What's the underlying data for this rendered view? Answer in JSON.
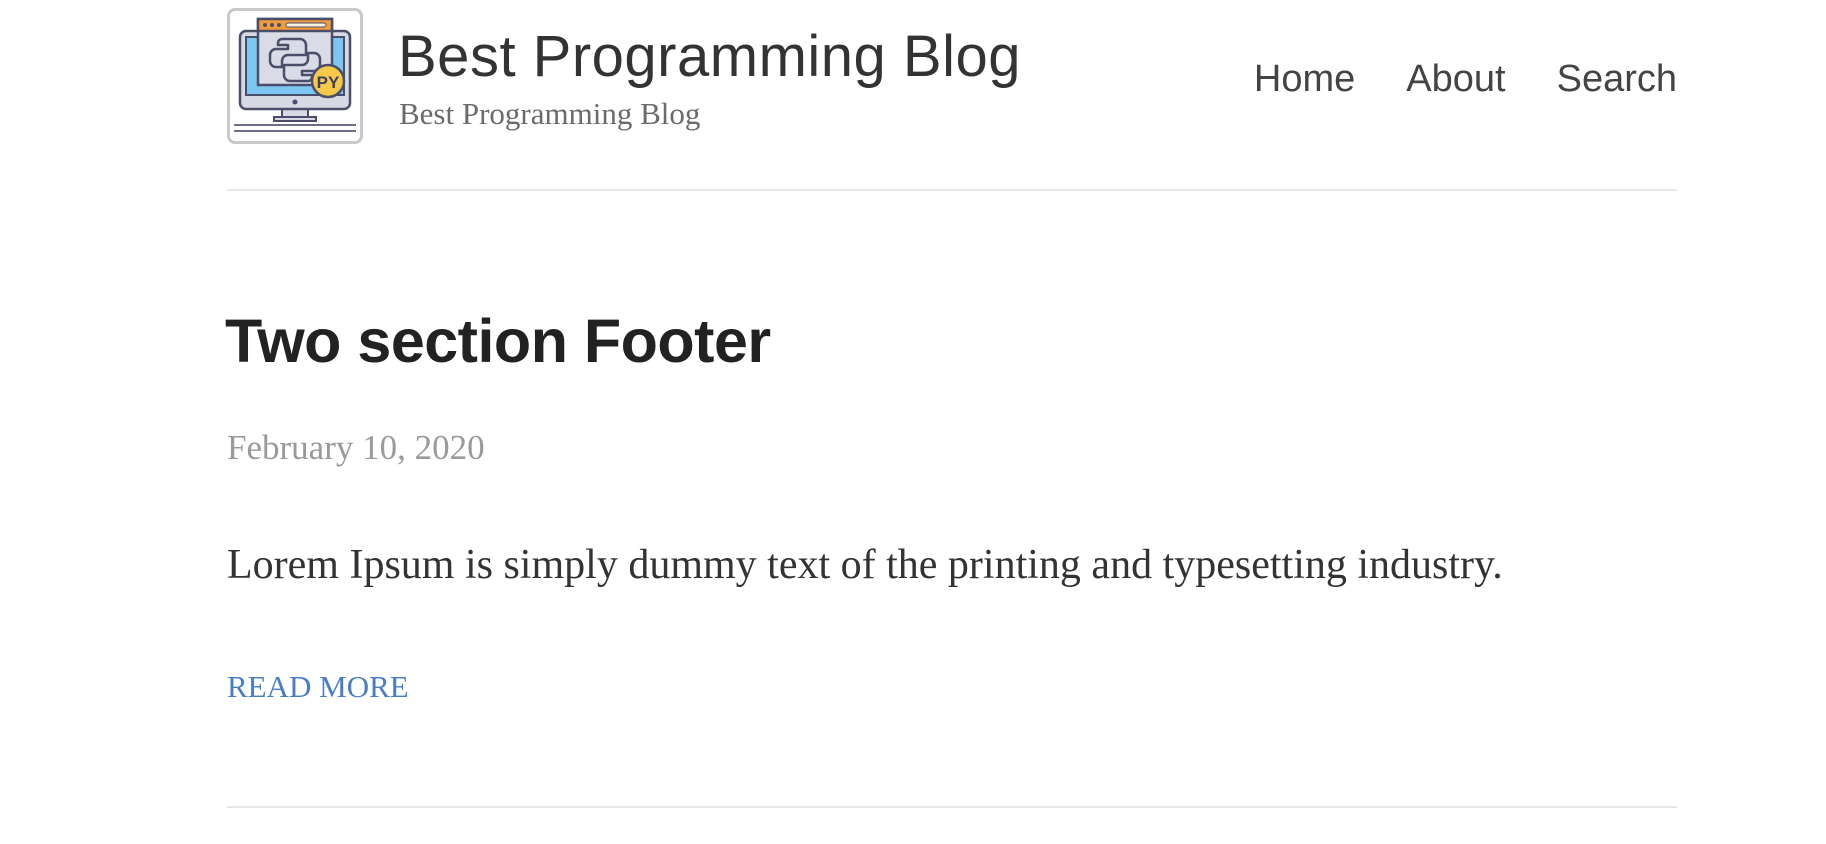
{
  "site": {
    "title": "Best Programming Blog",
    "tagline": "Best Programming Blog",
    "logo_icon": "python-monitor-icon",
    "logo_badge": "PY"
  },
  "nav": {
    "items": [
      {
        "label": "Home"
      },
      {
        "label": "About"
      },
      {
        "label": "Search"
      }
    ]
  },
  "post": {
    "title": "Two section Footer",
    "date": "February 10, 2020",
    "excerpt": "Lorem Ipsum is simply dummy text of the printing and typesetting industry.",
    "read_more": "READ MORE"
  },
  "colors": {
    "link": "#4a7ec2",
    "divider": "#e6e6e6",
    "muted_text": "#9a9a9a"
  }
}
